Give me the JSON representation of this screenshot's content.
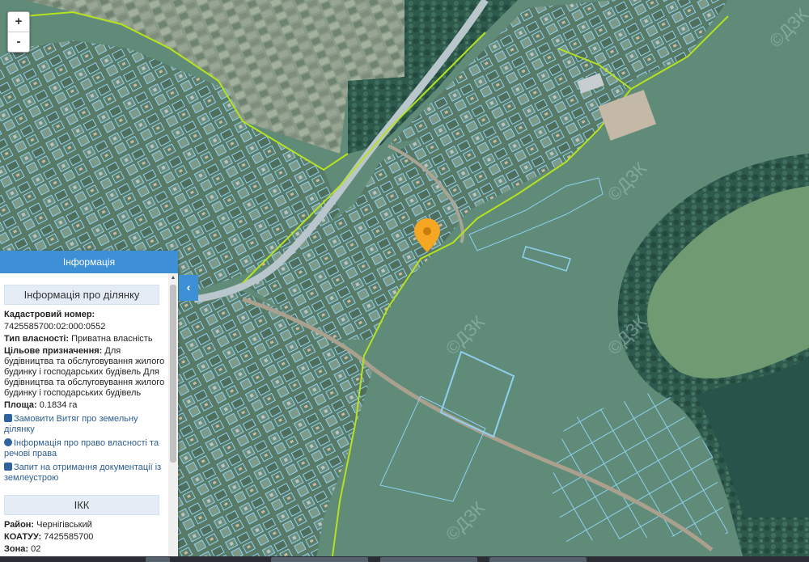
{
  "map": {
    "zoom_in": "+",
    "zoom_out": "-",
    "watermark": "©ДЗК",
    "colors": {
      "boundary_green": "#b6e21f",
      "parcel_blue": "#8fd0f0",
      "marker": "#f5a623",
      "panel_header": "#3d8fd6"
    }
  },
  "panel": {
    "header": "Інформація",
    "collapse_icon": "‹",
    "parcel_section": "Інформація про ділянку",
    "cadastral_label": "Кадастровий номер:",
    "cadastral_value": "7425585700:02:000:0552",
    "ownership_label": "Тип власності:",
    "ownership_value": "Приватна власність",
    "purpose_label": "Цільове призначення:",
    "purpose_value": "Для будівництва та обслуговування жилого будинку і господарських будівель Для будівництва та обслуговування жилого будинку і господарських будівель",
    "area_label": "Площа:",
    "area_value": "0.1834 га",
    "link_extract": "Замовити Витяг про земельну ділянку",
    "link_rights": "Інформація про право власності та речові права",
    "link_request": "Запит на отримання документації із землеустрою",
    "ikk_section": "ІКК",
    "district_label": "Район:",
    "district_value": "Чернігівський",
    "koatuu_label": "КОАТУУ:",
    "koatuu_value": "7425585700",
    "zone_label": "Зона:",
    "zone_value": "02"
  }
}
